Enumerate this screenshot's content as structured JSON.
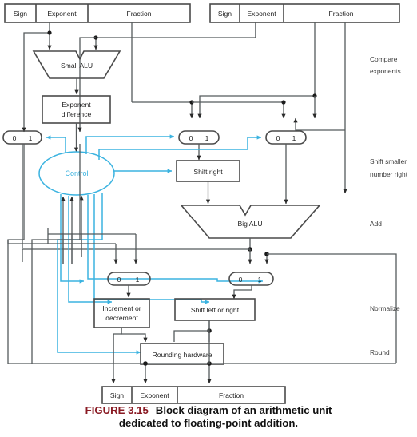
{
  "figure": {
    "label": "FIGURE 3.15",
    "caption_line1": "Block diagram of an arithmetic unit",
    "caption_line2": "dedicated to floating-point addition.",
    "label_color": "#8a1b24",
    "caption_color": "#111111"
  },
  "colors": {
    "control_blue": "#3bb3e0",
    "wire_gray": "#555a5c",
    "box_stroke": "#4a4a4a",
    "background": "#ffffff"
  },
  "registers": {
    "input_left": {
      "fields": [
        "Sign",
        "Exponent",
        "Fraction"
      ]
    },
    "input_right": {
      "fields": [
        "Sign",
        "Exponent",
        "Fraction"
      ]
    },
    "output": {
      "fields": [
        "Sign",
        "Exponent",
        "Fraction"
      ]
    }
  },
  "blocks": {
    "small_alu": "Small ALU",
    "exponent_difference_l1": "Exponent",
    "exponent_difference_l2": "difference",
    "control": "Control",
    "shift_right": "Shift right",
    "big_alu": "Big ALU",
    "increment_or_decrement_l1": "Increment or",
    "increment_or_decrement_l2": "decrement",
    "shift_left_or_right": "Shift left or right",
    "rounding_hardware": "Rounding hardware"
  },
  "muxes": [
    {
      "id": "mux-exponent-select",
      "inputs": [
        "0",
        "1"
      ]
    },
    {
      "id": "mux-fraction-small",
      "inputs": [
        "0",
        "1"
      ]
    },
    {
      "id": "mux-fraction-big",
      "inputs": [
        "0",
        "1"
      ]
    },
    {
      "id": "mux-exponent-normalize",
      "inputs": [
        "0",
        "1"
      ]
    },
    {
      "id": "mux-fraction-normalize",
      "inputs": [
        "0",
        "1"
      ]
    }
  ],
  "stage_labels": [
    {
      "id": "compare-exponents",
      "line1": "Compare",
      "line2": "exponents"
    },
    {
      "id": "shift-smaller-number-right",
      "line1": "Shift smaller",
      "line2": "number right"
    },
    {
      "id": "add",
      "line1": "Add",
      "line2": ""
    },
    {
      "id": "normalize",
      "line1": "Normalize",
      "line2": ""
    },
    {
      "id": "round",
      "line1": "Round",
      "line2": ""
    }
  ]
}
